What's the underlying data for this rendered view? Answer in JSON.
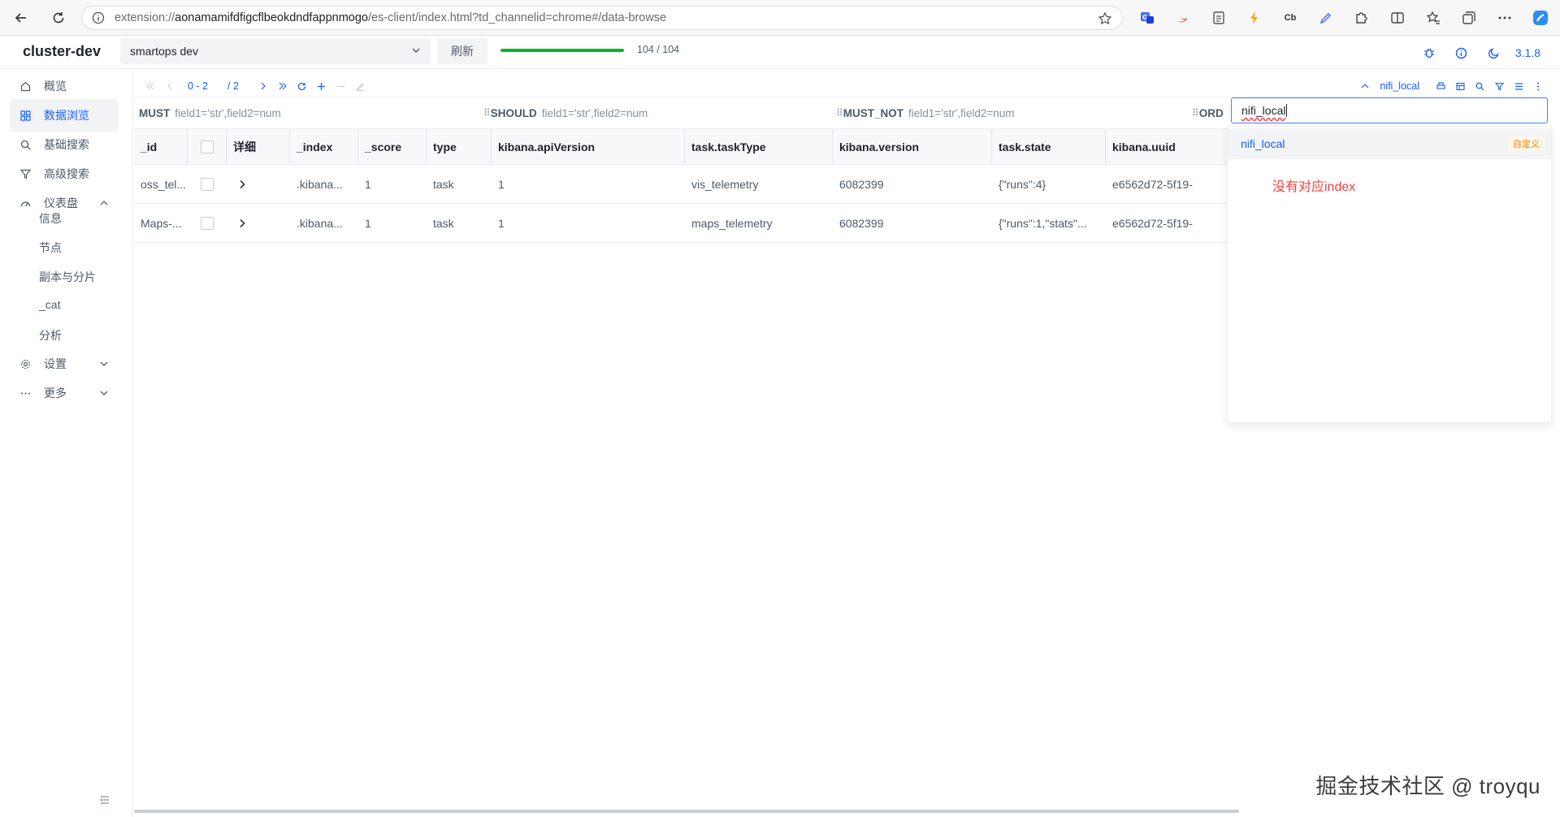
{
  "browser": {
    "url_prefix": "extension://",
    "url_host": "aonamamifdfigcflbeokdndfappnmogo",
    "url_path": "/es-client/index.html?td_channelid=chrome#/data-browse",
    "ext_cb": "Cb"
  },
  "header": {
    "brand": "cluster-dev",
    "cluster_name": "smartops dev",
    "refresh_label": "刷新",
    "progress_text": "104 / 104",
    "progress_fraction": 1.0,
    "version": "3.1.8"
  },
  "sidebar": {
    "items": [
      {
        "label": "概览",
        "icon": "home-icon"
      },
      {
        "label": "数据浏览",
        "icon": "grid-icon"
      },
      {
        "label": "基础搜索",
        "icon": "search-icon"
      },
      {
        "label": "高级搜索",
        "icon": "filter-icon"
      },
      {
        "label": "仪表盘",
        "icon": "dashboard-icon"
      },
      {
        "label": "设置",
        "icon": "gear-icon"
      },
      {
        "label": "更多",
        "icon": "more-icon"
      }
    ],
    "sub_items": [
      "信息",
      "节点",
      "副本与分片",
      "_cat",
      "分析"
    ]
  },
  "toolbar": {
    "range": "0 - 2",
    "total_pages": "/ 2",
    "index_name": "nifi_local"
  },
  "filters": {
    "must": {
      "label": "MUST",
      "placeholder": "field1='str',field2=num"
    },
    "should": {
      "label": "SHOULD",
      "placeholder": "field1='str',field2=num"
    },
    "must_not": {
      "label": "MUST_NOT",
      "placeholder": "field1='str',field2=num"
    },
    "order": {
      "label": "ORD"
    }
  },
  "table": {
    "columns": [
      "_id",
      "详细",
      "_index",
      "_score",
      "type",
      "kibana.apiVersion",
      "task.taskType",
      "kibana.version",
      "task.state",
      "kibana.uuid"
    ],
    "rows": [
      {
        "id": "oss_tel...",
        "index": ".kibana...",
        "score": "1",
        "type": "task",
        "apiVersion": "1",
        "taskType": "vis_telemetry",
        "version": "6082399",
        "state": "{\"runs\":4}",
        "uuid": "e6562d72-5f19-"
      },
      {
        "id": "Maps-...",
        "index": ".kibana...",
        "score": "1",
        "type": "task",
        "apiVersion": "1",
        "taskType": "maps_telemetry",
        "version": "6082399",
        "state": "{\"runs\":1,\"stats\"...",
        "uuid": "e6562d72-5f19-"
      }
    ]
  },
  "index_picker": {
    "value": "nifi_local",
    "option": "nifi_local",
    "option_tag": "自定义",
    "note": "没有对应index"
  },
  "watermark": "掘金技术社区 @ troyqu"
}
